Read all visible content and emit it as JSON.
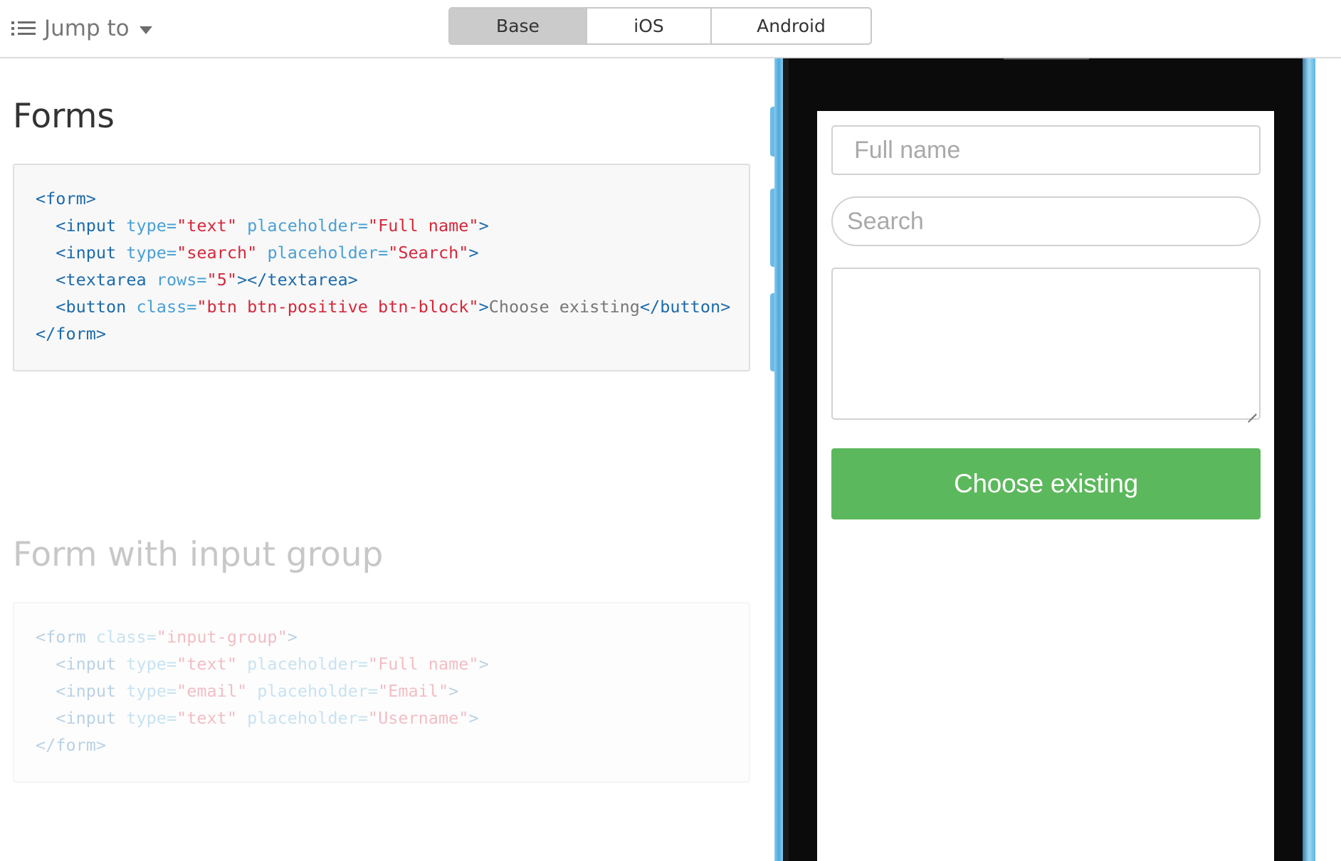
{
  "topbar": {
    "jump_label": "Jump to",
    "platform_tabs": [
      {
        "label": "Base",
        "active": true
      },
      {
        "label": "iOS",
        "active": false
      },
      {
        "label": "Android",
        "active": false
      }
    ]
  },
  "sections": [
    {
      "title": "Forms",
      "code": {
        "l1_open": "<form>",
        "l2_tag": "<input",
        "l2_a1": "type=",
        "l2_v1": "\"text\"",
        "l2_a2": "placeholder=",
        "l2_v2": "\"Full name\"",
        "l2_close": ">",
        "l3_tag": "<input",
        "l3_a1": "type=",
        "l3_v1": "\"search\"",
        "l3_a2": "placeholder=",
        "l3_v2": "\"Search\"",
        "l3_close": ">",
        "l4_tag": "<textarea",
        "l4_a1": "rows=",
        "l4_v1": "\"5\"",
        "l4_close": "></textarea>",
        "l5_tag": "<button",
        "l5_a1": "class=",
        "l5_v1": "\"btn btn-positive btn-block\"",
        "l5_gt": ">",
        "l5_text": "Choose existing",
        "l5_close": "</button>",
        "l6_close": "</form>"
      }
    },
    {
      "title": "Form with input group",
      "code": {
        "l1_tag": "<form",
        "l1_a1": "class=",
        "l1_v1": "\"input-group\"",
        "l1_close": ">",
        "l2_tag": "<input",
        "l2_a1": "type=",
        "l2_v1": "\"text\"",
        "l2_a2": "placeholder=",
        "l2_v2": "\"Full name\"",
        "l2_close": ">",
        "l3_tag": "<input",
        "l3_a1": "type=",
        "l3_v1": "\"email\"",
        "l3_a2": "placeholder=",
        "l3_v2": "\"Email\"",
        "l3_close": ">",
        "l4_tag": "<input",
        "l4_a1": "type=",
        "l4_v1": "\"text\"",
        "l4_a2": "placeholder=",
        "l4_v2": "\"Username\"",
        "l4_close": ">",
        "l5_close": "</form>"
      }
    }
  ],
  "phone_preview": {
    "full_name_placeholder": "Full name",
    "search_placeholder": "Search",
    "button_label": "Choose existing",
    "button_color": "#5cb85c"
  },
  "colors": {
    "tag": "#1c6bab",
    "attr": "#4aa0d4",
    "value": "#d4293b",
    "phone_rail": "#4aa8df"
  }
}
